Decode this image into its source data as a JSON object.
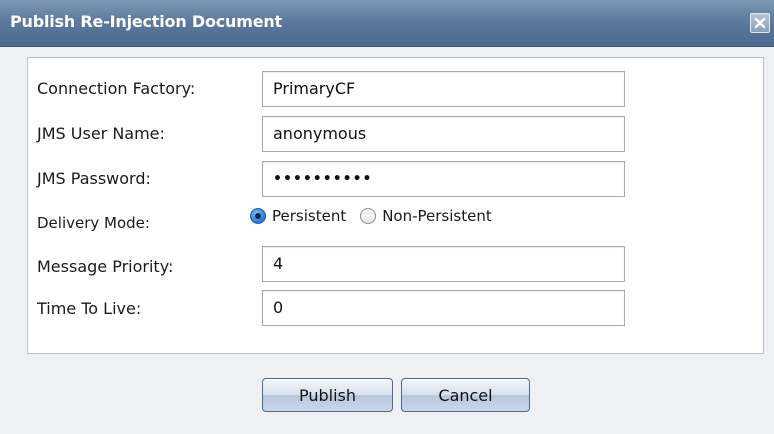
{
  "dialog": {
    "title": "Publish Re-Injection Document",
    "close_icon": "close-icon"
  },
  "form": {
    "connection_factory": {
      "label": "Connection Factory:",
      "value": "PrimaryCF"
    },
    "jms_user_name": {
      "label": "JMS User Name:",
      "value": "anonymous"
    },
    "jms_password": {
      "label": "JMS Password:",
      "value": "••••••••••"
    },
    "delivery_mode": {
      "label": "Delivery Mode:",
      "options": [
        {
          "label": "Persistent",
          "selected": true
        },
        {
          "label": "Non-Persistent",
          "selected": false
        }
      ]
    },
    "message_priority": {
      "label": "Message Priority:",
      "value": "4"
    },
    "time_to_live": {
      "label": "Time To Live:",
      "value": "0"
    }
  },
  "buttons": {
    "publish": "Publish",
    "cancel": "Cancel"
  },
  "colors": {
    "titlebar": "#5d7a9d",
    "radio_selected": "#2a7fe0"
  }
}
